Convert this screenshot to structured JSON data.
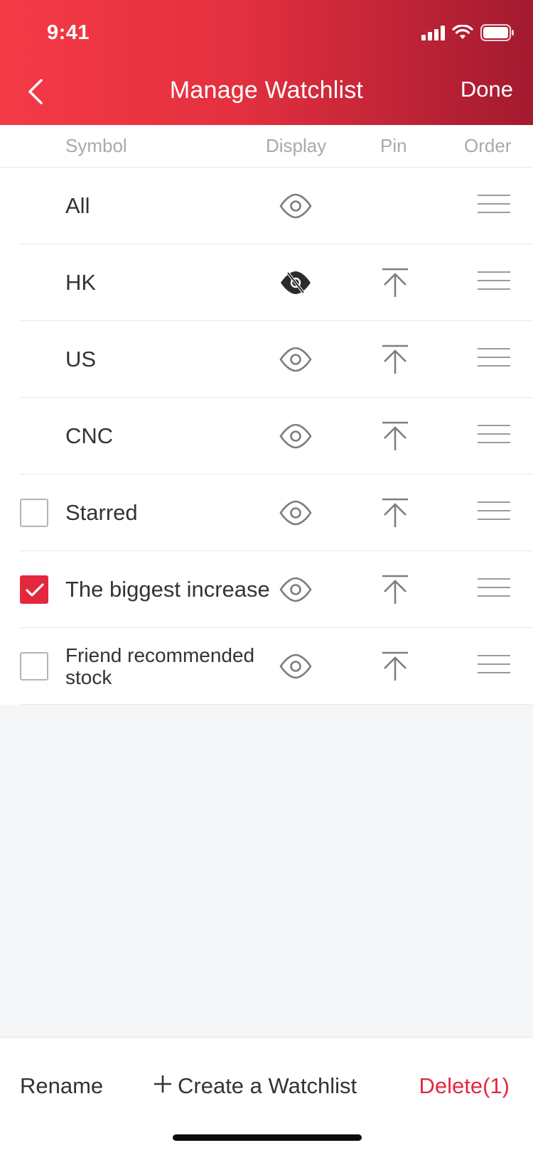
{
  "status_bar": {
    "time": "9:41"
  },
  "nav": {
    "title": "Manage Watchlist",
    "done_label": "Done"
  },
  "columns": {
    "symbol": "Symbol",
    "display": "Display",
    "pin": "Pin",
    "order": "Order"
  },
  "rows": [
    {
      "label": "All",
      "checkbox": "none",
      "visible": true,
      "pinnable": false
    },
    {
      "label": "HK",
      "checkbox": "none",
      "visible": false,
      "pinnable": true
    },
    {
      "label": "US",
      "checkbox": "none",
      "visible": true,
      "pinnable": true
    },
    {
      "label": "CNC",
      "checkbox": "none",
      "visible": true,
      "pinnable": true
    },
    {
      "label": "Starred",
      "checkbox": "unchecked",
      "visible": true,
      "pinnable": true
    },
    {
      "label": "The biggest increase",
      "checkbox": "checked",
      "visible": true,
      "pinnable": true
    },
    {
      "label": "Friend recommended stock",
      "checkbox": "unchecked",
      "visible": true,
      "pinnable": true
    }
  ],
  "bottom": {
    "rename_label": "Rename",
    "create_label": "Create a Watchlist",
    "delete_label": "Delete(1)"
  },
  "colors": {
    "accent": "#e3283d",
    "header_start": "#f53a47",
    "header_end": "#a31a2f"
  },
  "icons": {
    "back": "chevron-left-icon",
    "display_on": "eye-icon",
    "display_off": "eye-slash-icon",
    "pin": "pin-to-top-icon",
    "order": "drag-handle-icon",
    "create": "plus-icon"
  }
}
